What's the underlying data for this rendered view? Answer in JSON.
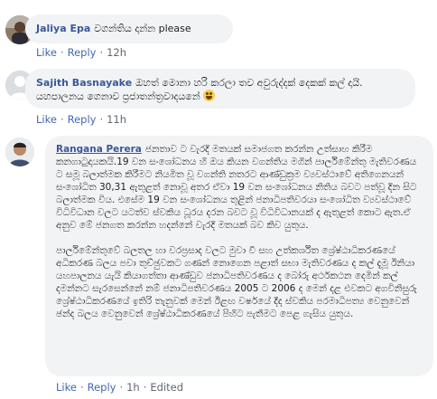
{
  "comments": [
    {
      "author": "Jaliya Epa",
      "text": "වගන්තිය දාන්න please",
      "like": "Like",
      "reply": "Reply",
      "time": "12h",
      "edited": ""
    },
    {
      "author": "Sajith Basnayake",
      "text": "ඔහත් මොනා හරි කරලා තව අවුරුද්දක් දෙකක් කල් දායි. යහපාලනය ගෙනාව ප්‍රජාතන්ත්‍රවාදයනේ",
      "emoji": "laughing-emoji",
      "like": "Like",
      "reply": "Reply",
      "time": "11h",
      "edited": ""
    },
    {
      "author": "Rangana Perera",
      "paragraphs": [
        "ජනතාව ට වැරදි මතයක් සමාජගත කරන්න උත්සාහ කිරීම කනගාටුදායකයි.19 වන සංශෝධනය හි ඔය කියන වගන්තිය මගින් පාර්ලිමේන්තු මැතිවරණය ට සමූ බලාත්මක කිරීමට නියමිත වූ වගන්ති නතරට ආණ්ඩුක්‍රම ව්‍යවස්ථාවේ අතිගෙනයන් සංශෝධිත 30,31 ඇතුළත් නොවූ අතර ඒවා 19 වන සංශෝධනය නිතිය බවට පත්වූ දින සිට බලාත්මක විය. එසේම 19 වන සංශෝධනය තුළින් ජනාධිපතිවරයා සංශෝධිත ව්‍යවස්ථාවේ විධිවිධාන වලට යටත්ව ස්වකිය ධූරය දරන බවට වූ විධිවිධානයක් ද ඇතුළත් කොට ඇත.ඒ අනුව මේ ජනගත කරන්න හදන්නේ වැරදි මතයක් බව කිව යුතුය.",
        "පාර්ලිමේන්තුවේ බලතල හා වරප්‍රසාද වලට මුවා වී සහ උත්කර්ශිත ශ්‍රේෂ්ඨාධිකරණයේ අධිකරණ බලය පවා තුච්ඡුවකට ගණන් නොගෙන පළාත් සභා මැතිවරණය ද කල් දැමූ ඊනියා යහපාලනය යැයි කියාගත්තා ආණ්ඩුව ජනාධිපතිවරණය ද බෝරු අර්ථකථන දෙමින් කල් දමන්නට සැරසෙන්නේ නම් ජනාධිපතිවරණය 2005 ට 2006 ද මෙන් දළ එවකට අගවිනිසුරු ශ්‍රේෂ්ඨාධිකරණයේ ඉතිරි තැනුවක් මෙන් ඊළඟ වර්ෂයේ දීද ස්වකිය පරමාධිපත්‍ය වෙනුවෙන් ඡන්ද බලය වෙනුවෙන් ශ්‍රේෂ්ඨාධිකරණයේ පිහිට පැතීමට පෙළ ගැසිය යුතුය."
      ],
      "like": "Like",
      "reply": "Reply",
      "time": "1h",
      "edited": "Edited"
    }
  ]
}
